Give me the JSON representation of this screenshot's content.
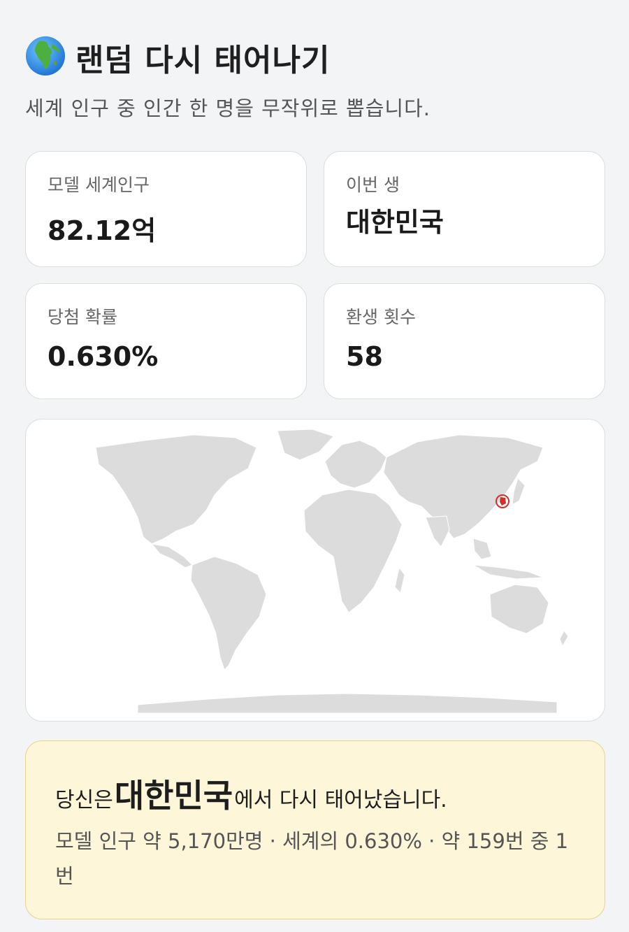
{
  "header": {
    "icon": "globe-africa-icon",
    "title": "랜덤 다시 태어나기",
    "subtitle": "세계 인구 중 인간 한 명을 무작위로 뽑습니다."
  },
  "stats": [
    {
      "label": "모델 세계인구",
      "value": "82.12억"
    },
    {
      "label": "이번 생",
      "value": "대한민국"
    },
    {
      "label": "당첨 확률",
      "value": "0.630%"
    },
    {
      "label": "환생 횟수",
      "value": "58"
    }
  ],
  "map": {
    "land_color": "#dcdcdc",
    "marker_color": "#d0312d",
    "highlighted_country": "대한민국"
  },
  "result": {
    "prefix": "당신은",
    "country": "대한민국",
    "suffix": "에서 다시 태어났습니다.",
    "detail": "모델 인구 약 5,170만명 · 세계의 0.630% · 약 159번 중 1번"
  }
}
